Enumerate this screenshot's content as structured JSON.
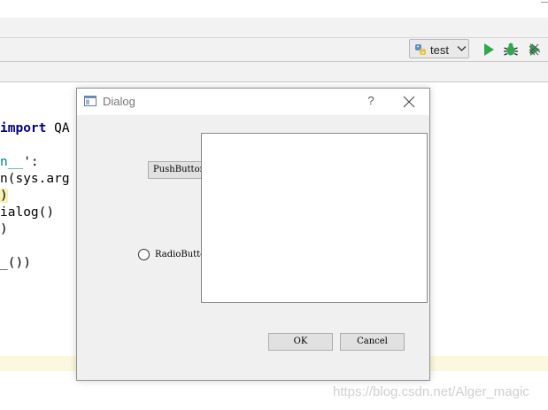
{
  "ide": {
    "run_config": {
      "name": "test"
    },
    "code_lines": [
      {
        "parts": [
          {
            "text": "import",
            "cls": "kw"
          },
          {
            "text": " QA",
            "cls": ""
          }
        ]
      },
      {
        "parts": [
          {
            "text": "n__",
            "cls": "kw2"
          },
          {
            "text": "':",
            "cls": ""
          }
        ]
      },
      {
        "parts": [
          {
            "text": "n(sys.arg",
            "cls": ""
          }
        ]
      },
      {
        "parts": [
          {
            "text": ")",
            "cls": "hl-bracket"
          }
        ]
      },
      {
        "parts": [
          {
            "text": "ialog()",
            "cls": ""
          }
        ]
      },
      {
        "parts": [
          {
            "text": ")",
            "cls": ""
          }
        ]
      },
      {
        "parts": [
          {
            "text": "_())",
            "cls": ""
          }
        ]
      }
    ],
    "watermark": "https://blog.csdn.net/Alger_magic"
  },
  "dialog": {
    "title": "Dialog",
    "help_label": "?",
    "push_button": "PushButton",
    "radio_button": "RadioButton",
    "ok": "OK",
    "cancel": "Cancel"
  },
  "colors": {
    "run_green": "#2fa84f",
    "keyword_blue": "#000080",
    "keyword_teal": "#008080",
    "current_line": "#fcf8df"
  }
}
